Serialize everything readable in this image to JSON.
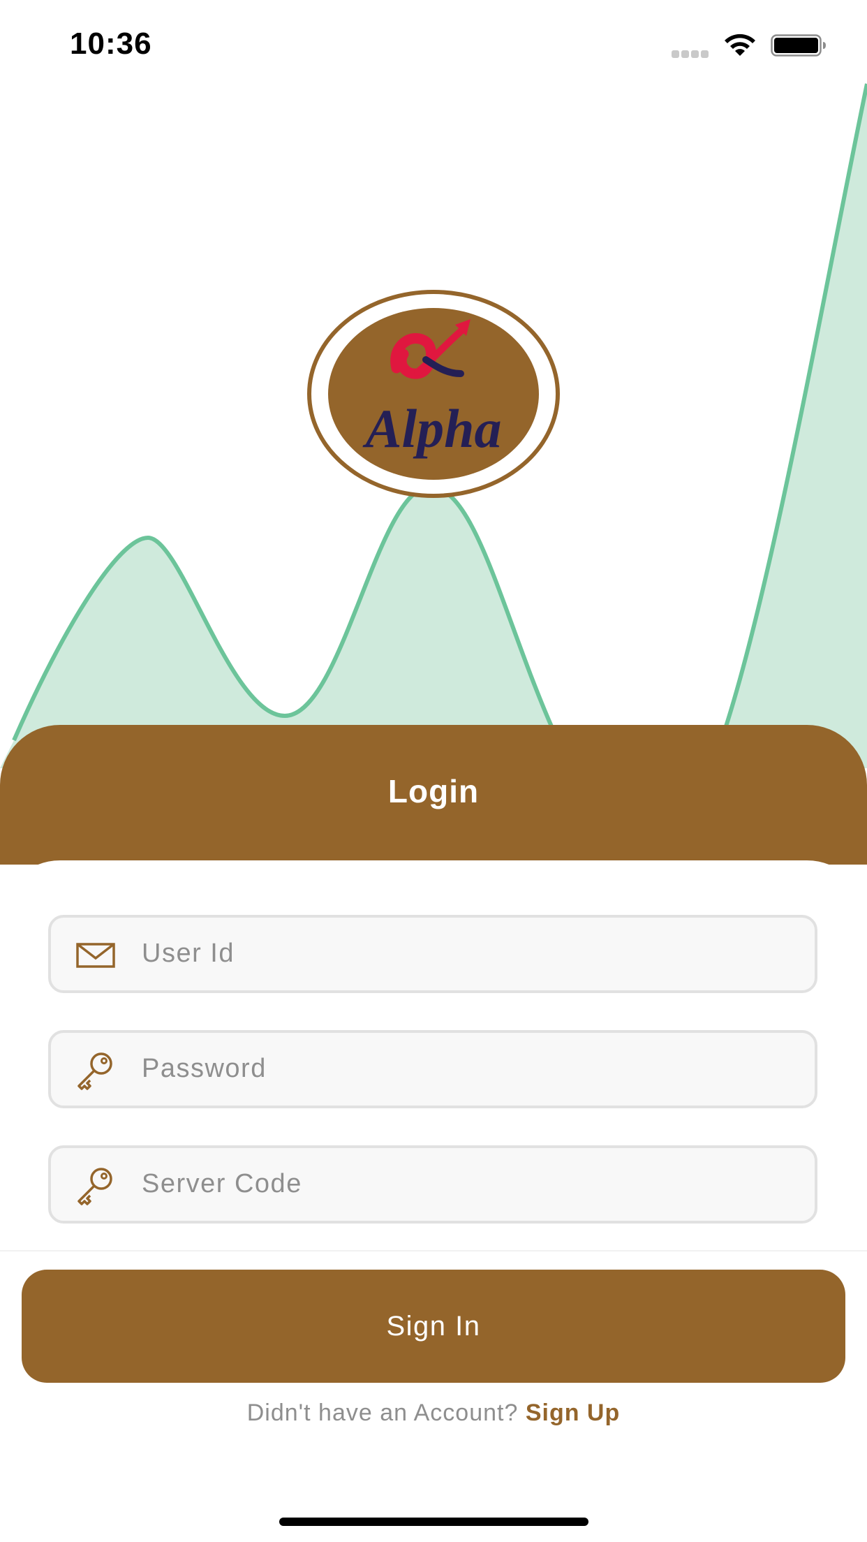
{
  "status_bar": {
    "time": "10:36",
    "icons": [
      "signal-dots-icon",
      "wifi-icon",
      "battery-icon"
    ]
  },
  "logo": {
    "text": "Alpha",
    "icon": "alpha-logo"
  },
  "login": {
    "title": "Login"
  },
  "form": {
    "user_id": {
      "placeholder": "User Id",
      "icon": "mail-icon",
      "value": ""
    },
    "password": {
      "placeholder": "Password",
      "icon": "key-icon",
      "value": ""
    },
    "server_code": {
      "placeholder": "Server Code",
      "icon": "key-icon",
      "value": ""
    }
  },
  "actions": {
    "sign_in_label": "Sign In",
    "signup_prompt": "Didn't have an Account?",
    "signup_link": "Sign Up"
  },
  "colors": {
    "brand": "#94652b",
    "wave_line": "#6cc49a",
    "wave_fill": "#cfeadc",
    "logo_text": "#241f55",
    "logo_accent": "#e0173f"
  }
}
